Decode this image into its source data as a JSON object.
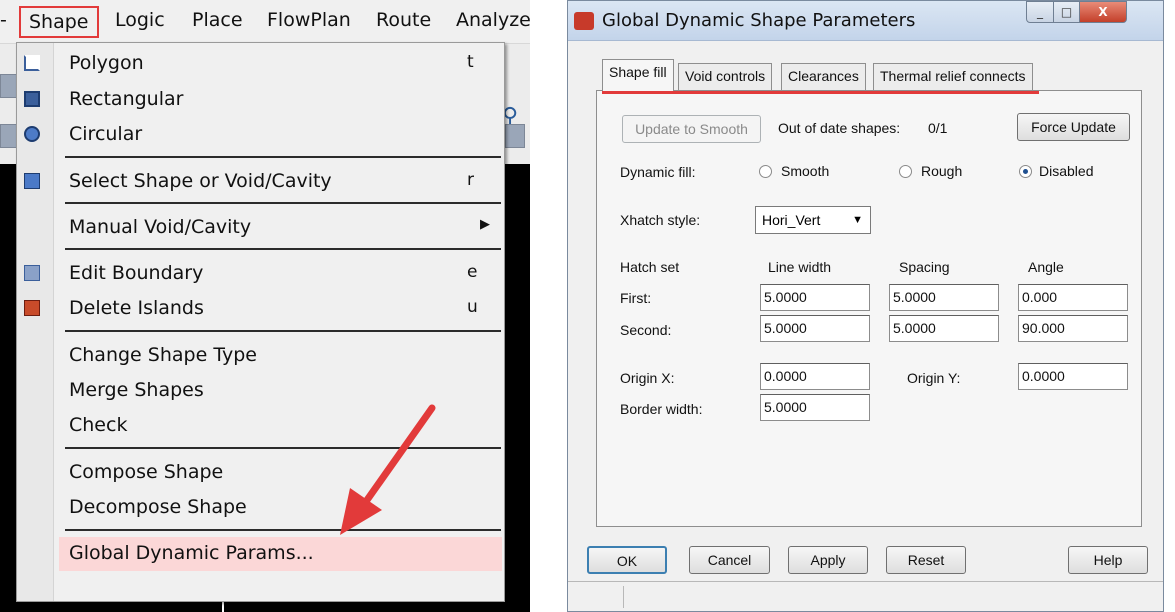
{
  "menubar": {
    "items": [
      {
        "label": "Shape",
        "active": true
      },
      {
        "label": "Logic"
      },
      {
        "label": "Place"
      },
      {
        "label": "FlowPlan"
      },
      {
        "label": "Route"
      },
      {
        "label": "Analyze"
      }
    ]
  },
  "shape_menu": {
    "items": [
      {
        "label": "Polygon",
        "shortcut": "t",
        "icon": "polygon-icon"
      },
      {
        "label": "Rectangular",
        "icon": "rectangle-icon"
      },
      {
        "label": "Circular",
        "icon": "circle-icon"
      },
      {
        "label": "Select Shape or Void/Cavity",
        "shortcut": "r",
        "icon": "select-shape-icon"
      },
      {
        "label": "Manual Void/Cavity",
        "submenu": true,
        "arrow": "▶"
      },
      {
        "label": "Edit Boundary",
        "shortcut": "e",
        "icon": "edit-boundary-icon"
      },
      {
        "label": "Delete Islands",
        "shortcut": "u",
        "icon": "delete-islands-icon"
      },
      {
        "label": "Change Shape Type"
      },
      {
        "label": "Merge Shapes"
      },
      {
        "label": "Check"
      },
      {
        "label": "Compose Shape"
      },
      {
        "label": "Decompose Shape"
      },
      {
        "label": "Global Dynamic Params...",
        "highlighted": true
      }
    ]
  },
  "annotation": {
    "arrow_color": "#e23a3a",
    "highlight_color": "#e23a3a"
  },
  "dialog": {
    "title": "Global Dynamic Shape Parameters",
    "tabs": [
      "Shape fill",
      "Void controls",
      "Clearances",
      "Thermal relief connects"
    ],
    "active_tab": "Shape fill",
    "update_smooth_label": "Update to Smooth",
    "out_of_date_label": "Out of date shapes:",
    "out_of_date_value": "0/1",
    "force_update_label": "Force Update",
    "dynamic_fill_label": "Dynamic fill:",
    "fill_options": [
      "Smooth",
      "Rough",
      "Disabled"
    ],
    "fill_selected": "Disabled",
    "xhatch_label": "Xhatch style:",
    "xhatch_value": "Hori_Vert",
    "hatch_headers": [
      "Hatch set",
      "Line width",
      "Spacing",
      "Angle"
    ],
    "hatch_rows": [
      {
        "label": "First:",
        "line_width": "5.0000",
        "spacing": "5.0000",
        "angle": "0.000"
      },
      {
        "label": "Second:",
        "line_width": "5.0000",
        "spacing": "5.0000",
        "angle": "90.000"
      }
    ],
    "origin_x_label": "Origin X:",
    "origin_x": "0.0000",
    "origin_y_label": "Origin Y:",
    "origin_y": "0.0000",
    "border_width_label": "Border width:",
    "border_width": "5.0000",
    "buttons": {
      "ok": "OK",
      "cancel": "Cancel",
      "apply": "Apply",
      "reset": "Reset",
      "help": "Help"
    },
    "window_buttons": {
      "minimize": "_",
      "maximize": "□",
      "close": "X"
    }
  }
}
